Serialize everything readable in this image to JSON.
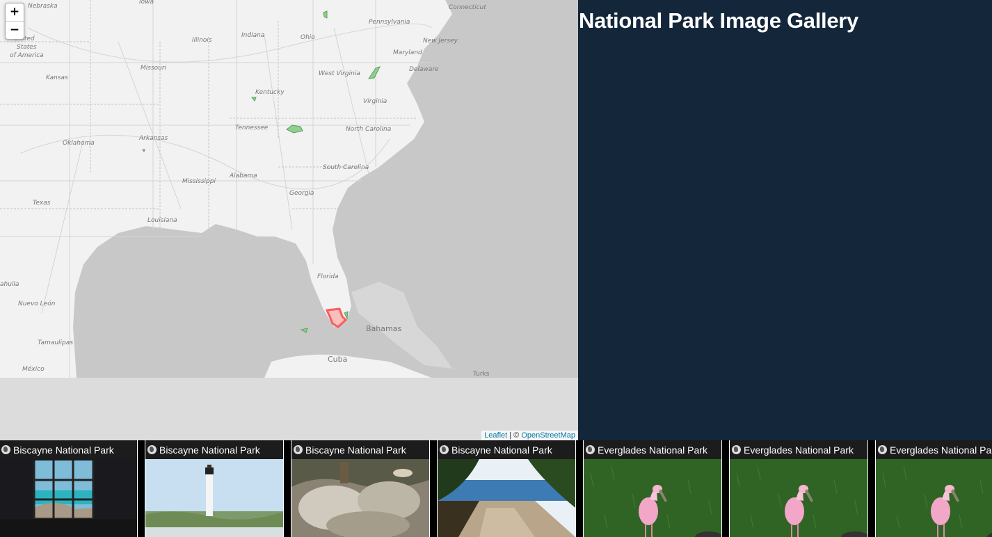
{
  "map": {
    "zoom_in": "+",
    "zoom_out": "−",
    "labels": [
      {
        "text": "Nebraska"
      },
      {
        "text": "Iowa"
      },
      {
        "text": "Connecticut"
      },
      {
        "text": "Pennsylvania"
      },
      {
        "text": "New Jersey"
      },
      {
        "text": "Indiana"
      },
      {
        "text": "Ohio"
      },
      {
        "text": "Illinois"
      },
      {
        "text": "United"
      },
      {
        "text": "States"
      },
      {
        "text": "of America"
      },
      {
        "text": "Maryland"
      },
      {
        "text": "Delaware"
      },
      {
        "text": "Missouri"
      },
      {
        "text": "West Virginia"
      },
      {
        "text": "Kansas"
      },
      {
        "text": "Kentucky"
      },
      {
        "text": "Virginia"
      },
      {
        "text": "Tennessee"
      },
      {
        "text": "North Carolina"
      },
      {
        "text": "Oklahoma"
      },
      {
        "text": "Arkansas"
      },
      {
        "text": "South Carolina"
      },
      {
        "text": "Alabama"
      },
      {
        "text": "Mississippi"
      },
      {
        "text": "Georgia"
      },
      {
        "text": "Texas"
      },
      {
        "text": "Louisiana"
      },
      {
        "text": "Florida"
      },
      {
        "text": "ahuila"
      },
      {
        "text": "Nuevo León"
      },
      {
        "text": "Bahamas"
      },
      {
        "text": "Tamaulipas"
      },
      {
        "text": "Cuba"
      },
      {
        "text": "México"
      },
      {
        "text": "Turks"
      }
    ],
    "attribution": {
      "leaflet": "Leaflet",
      "sep": " | © ",
      "osm": "OpenStreetMap"
    },
    "colors": {
      "land": "#f2f2f2",
      "water": "#c8c8c8",
      "park": "#8fcf8f",
      "highlight": "#ff5a5a"
    }
  },
  "panel": {
    "title": "National Park Image Gallery"
  },
  "gallery": [
    {
      "caption": "Biscayne National Park",
      "scene": "window"
    },
    {
      "caption": "Biscayne National Park",
      "scene": "lighthouse"
    },
    {
      "caption": "Biscayne National Park",
      "scene": "rocks"
    },
    {
      "caption": "Biscayne National Park",
      "scene": "shore"
    },
    {
      "caption": "Everglades National Park",
      "scene": "spoonbill"
    },
    {
      "caption": "Everglades National Park",
      "scene": "spoonbill"
    },
    {
      "caption": "Everglades National Park",
      "scene": "spoonbill"
    }
  ]
}
